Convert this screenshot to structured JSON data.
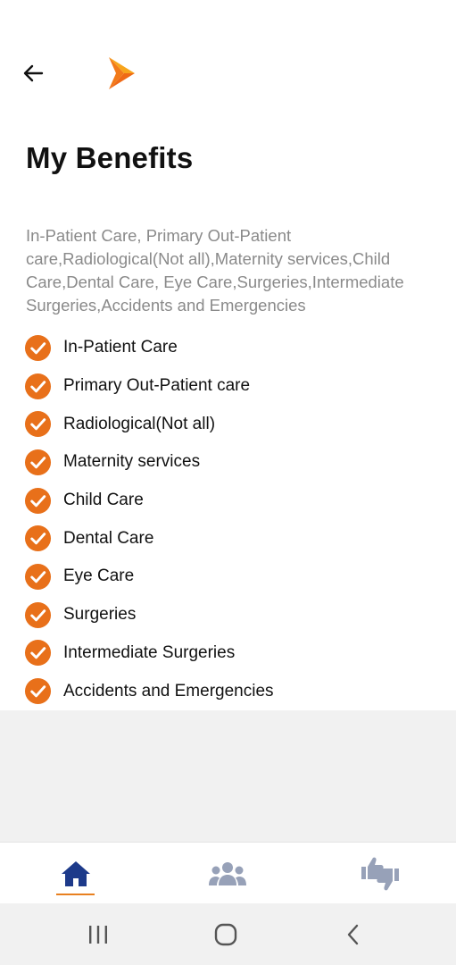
{
  "header": {
    "back_icon": "arrow-left-icon",
    "logo_icon": "brand-chevron-logo",
    "brand_color": "#f27a1a"
  },
  "page": {
    "title": "My Benefits",
    "summary": "In-Patient Care, Primary Out-Patient care,Radiological(Not all),Maternity services,Child Care,Dental Care, Eye Care,Surgeries,Intermediate Surgeries,Accidents and Emergencies"
  },
  "benefits": [
    {
      "label": "In-Patient Care"
    },
    {
      "label": "Primary Out-Patient care"
    },
    {
      "label": "Radiological(Not all)"
    },
    {
      "label": "Maternity services"
    },
    {
      "label": "Child Care"
    },
    {
      "label": "Dental Care"
    },
    {
      "label": "Eye Care"
    },
    {
      "label": "Surgeries"
    },
    {
      "label": "Intermediate Surgeries"
    },
    {
      "label": "Accidents and Emergencies"
    }
  ],
  "check_color": "#e8701a",
  "bottom_nav": {
    "items": [
      {
        "icon": "home-icon",
        "active": true,
        "color": "#1d3a8a"
      },
      {
        "icon": "group-icon",
        "active": false,
        "color": "#97a1b8"
      },
      {
        "icon": "thumbs-up-down-icon",
        "active": false,
        "color": "#97a1b8"
      }
    ],
    "active_underline_color": "#e8801f"
  },
  "system_nav": {
    "items": [
      "recent-apps-icon",
      "home-circle-icon",
      "back-chevron-icon"
    ]
  }
}
